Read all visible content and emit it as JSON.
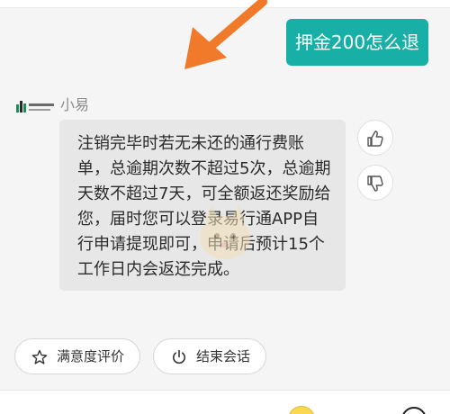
{
  "conversation": {
    "user_message": "押金200怎么退",
    "bot_name": "小易",
    "bot_reply": "注销完毕时若无未还的通行费账单，总逾期次数不超过5次，总逾期天数不超过7天，可全额返还奖励给您，届时您可以登录易行通APP自行申请提现即可，申请后预计15个工作日内会返还完成。"
  },
  "actions": {
    "rate_label": "满意度评价",
    "end_label": "结束会话"
  },
  "colors": {
    "accent": "#18afa6",
    "arrow": "#f07a2a",
    "bot_bubble": "#e7e7e7",
    "background": "#f5f5f5"
  },
  "icons": {
    "like": "thumbs-up-icon",
    "dislike": "thumbs-down-icon",
    "rate": "star-icon",
    "end": "power-icon"
  }
}
